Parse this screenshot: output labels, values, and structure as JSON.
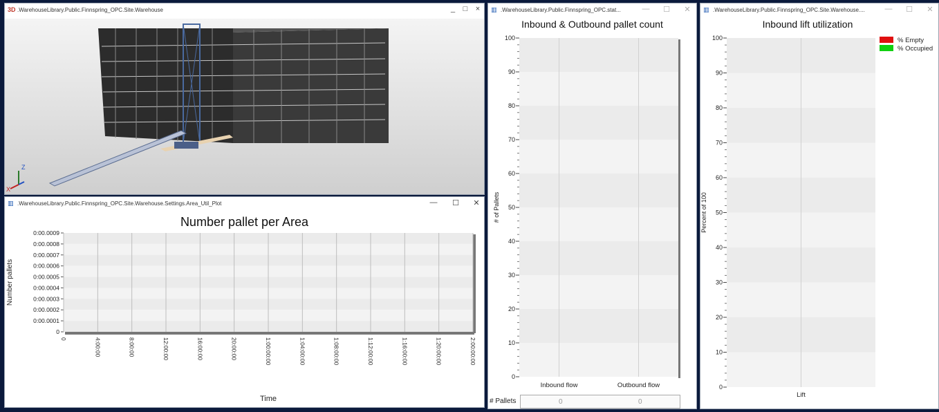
{
  "windows": {
    "view3d": {
      "icon": "3D",
      "title": ".WarehouseLibrary.Public.Finnspring_OPC.Site.Warehouse",
      "controls": [
        "_",
        "□",
        "×"
      ],
      "axes_label_z": "Z",
      "axes_label_x": "X"
    },
    "area_plot": {
      "title": ".WarehouseLibrary.Public.Finnspring_OPC.Site.Warehouse.Settings.Area_Util_Plot",
      "controls": [
        "—",
        "☐",
        "✕"
      ]
    },
    "pallet_count": {
      "title": ".WarehouseLibrary.Public.Finnspring_OPC.stat...",
      "controls": [
        "—",
        "☐",
        "✕"
      ],
      "table_label": "# Pallets",
      "table_values": [
        "0",
        "0"
      ]
    },
    "lift_util": {
      "title": ".WarehouseLibrary.Public.Finnspring_OPC.Site.Warehouse....",
      "controls": [
        "—",
        "☐",
        "✕"
      ]
    }
  },
  "chart_data": [
    {
      "type": "line",
      "title": "Number pallet per Area",
      "xlabel": "Time",
      "ylabel": "Number pallets",
      "x_ticks": [
        "0",
        "4:00:00",
        "8:00:00",
        "12:00:00",
        "16:00:00",
        "20:00:00",
        "1:00:00:00",
        "1:04:00:00",
        "1:08:00:00",
        "1:12:00:00",
        "1:16:00:00",
        "1:20:00:00",
        "2:00:00:00"
      ],
      "y_ticks": [
        "0",
        "0:00.0001",
        "0:00.0002",
        "0:00.0003",
        "0:00.0004",
        "0:00.0005",
        "0:00.0006",
        "0:00.0007",
        "0:00.0008",
        "0:00.0009"
      ],
      "series": [],
      "grid": true
    },
    {
      "type": "bar",
      "title": "Inbound & Outbound pallet count",
      "ylabel": "# of Pallets",
      "categories": [
        "Inbound flow",
        "Outbound flow"
      ],
      "values": [
        0,
        0
      ],
      "ylim": [
        0,
        100
      ],
      "y_ticks": [
        "0",
        "10",
        "20",
        "30",
        "40",
        "50",
        "60",
        "70",
        "80",
        "90",
        "100"
      ],
      "grid": true
    },
    {
      "type": "bar",
      "title": "Inbound lift utilization",
      "ylabel": "Percent of 100",
      "categories": [
        "Lift"
      ],
      "series": [
        {
          "name": "% Empty",
          "values": [
            0
          ],
          "color": "#e01010"
        },
        {
          "name": "% Occupied",
          "values": [
            0
          ],
          "color": "#10d010"
        }
      ],
      "ylim": [
        0,
        100
      ],
      "y_ticks": [
        "0",
        "10",
        "20",
        "30",
        "40",
        "50",
        "60",
        "70",
        "80",
        "90",
        "100"
      ],
      "legend": "top-right",
      "grid": true
    }
  ]
}
